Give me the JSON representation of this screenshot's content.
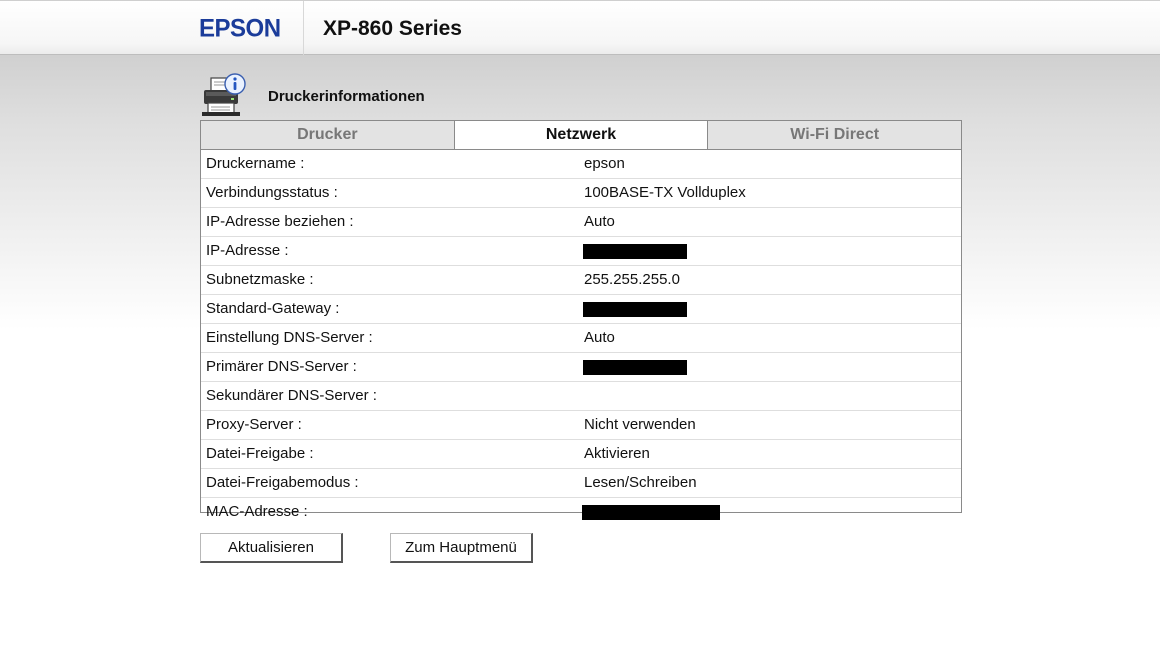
{
  "header": {
    "brand": "EPSON",
    "model": "XP-860 Series"
  },
  "page": {
    "title": "Druckerinformationen",
    "icon": "printer-info-icon"
  },
  "tabs": [
    {
      "label": "Drucker",
      "active": false
    },
    {
      "label": "Netzwerk",
      "active": true
    },
    {
      "label": "Wi-Fi Direct",
      "active": false
    }
  ],
  "rows": [
    {
      "label": "Druckername :",
      "value": "epson"
    },
    {
      "label": "Verbindungsstatus :",
      "value": "100BASE-TX Vollduplex"
    },
    {
      "label": "IP-Adresse beziehen :",
      "value": "Auto"
    },
    {
      "label": "IP-Adresse :",
      "value": "",
      "redacted": true
    },
    {
      "label": "Subnetzmaske :",
      "value": "255.255.255.0"
    },
    {
      "label": "Standard-Gateway :",
      "value": "",
      "redacted": true
    },
    {
      "label": "Einstellung DNS-Server :",
      "value": "Auto"
    },
    {
      "label": "Primärer DNS-Server :",
      "value": "",
      "redacted": true
    },
    {
      "label": "Sekundärer DNS-Server :",
      "value": ""
    },
    {
      "label": "Proxy-Server :",
      "value": "Nicht verwenden"
    },
    {
      "label": "Datei-Freigabe :",
      "value": "Aktivieren"
    },
    {
      "label": "Datei-Freigabemodus :",
      "value": "Lesen/Schreiben"
    },
    {
      "label": "MAC-Adresse :",
      "value": "",
      "redacted": true
    }
  ],
  "buttons": {
    "refresh": "Aktualisieren",
    "main_menu": "Zum Hauptmenü"
  },
  "colors": {
    "brand": "#1b3c9a",
    "redaction": "#000000"
  }
}
